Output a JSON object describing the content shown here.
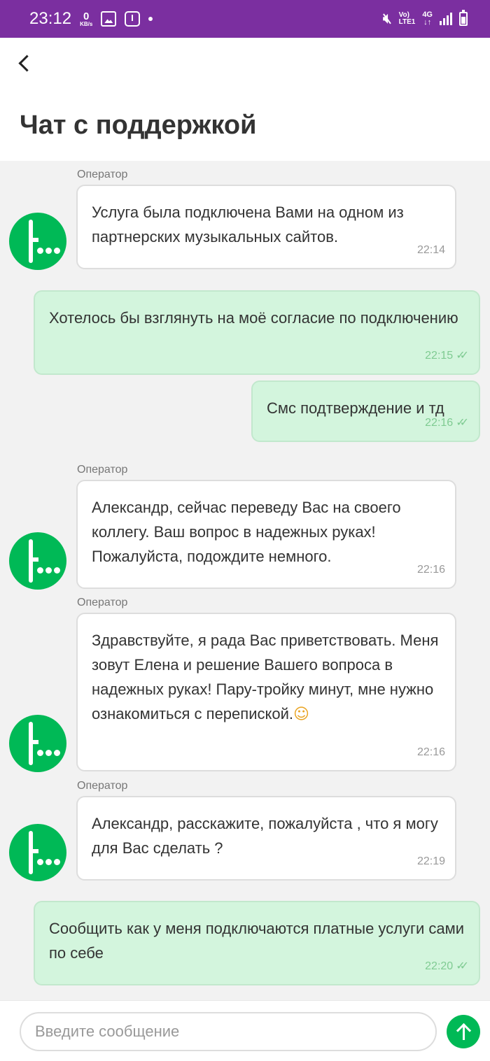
{
  "status_bar": {
    "time": "23:12",
    "net_speed_value": "0",
    "net_speed_unit": "KB/s",
    "volte": "Vo)",
    "lte": "LTE1",
    "network": "4G",
    "arrows": "↓↑"
  },
  "header": {
    "title": "Чат с поддержкой"
  },
  "messages": [
    {
      "sender": "Оператор",
      "text": "Услуга была подключена Вами на одном из партнерских музыкальных сайтов.",
      "time": "22:14"
    },
    {
      "text": "Хотелось бы взглянуть на моё согласие по подключению",
      "time": "22:15"
    },
    {
      "text": "Смс подтверждение и тд",
      "time": "22:16"
    },
    {
      "sender": "Оператор",
      "text": "Александр, сейчас переведу Вас на своего коллегу. Ваш вопрос в надежных руках! Пожалуйста, подождите немного.",
      "time": "22:16"
    },
    {
      "sender": "Оператор",
      "text": "Здравствуйте, я рада Вас приветствовать. Меня зовут Елена и решение Вашего вопроса в надежных руках! Пару-тройку минут, мне нужно ознакомиться с перепиской.",
      "emoji": "☺",
      "time": "22:16"
    },
    {
      "sender": "Оператор",
      "text": "Александр, расскажите, пожалуйста , что я могу для Вас сделать ?",
      "time": "22:19"
    },
    {
      "text": "Сообщить как у меня подключаются платные услуги сами по себе",
      "time": "22:20"
    }
  ],
  "ticks": "✓✓",
  "input": {
    "placeholder": "Введите сообщение"
  },
  "colors": {
    "status_bar": "#7b2fa0",
    "brand_green": "#00b956",
    "user_bubble": "#d3f5dd"
  }
}
